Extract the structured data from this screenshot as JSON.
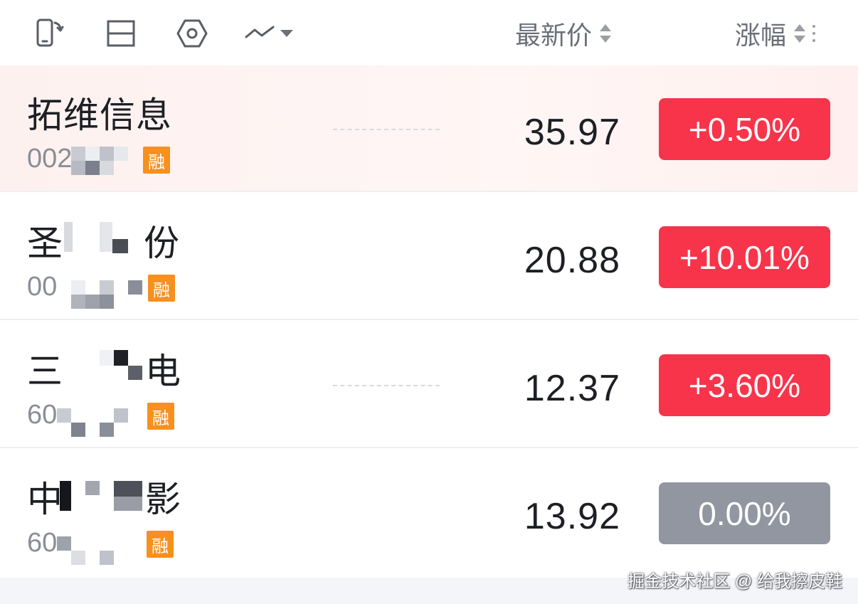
{
  "header": {
    "col_price": "最新价",
    "col_change": "涨幅",
    "icons": [
      "phone-rotate-icon",
      "split-layout-icon",
      "hexagon-settings-icon",
      "trend-line-icon",
      "caret-down-icon",
      "sort-icon",
      "more-vert-icon"
    ]
  },
  "rows": [
    {
      "name": "拓维信息",
      "code": "002",
      "badge": "融",
      "price": "35.97",
      "change": "+0.50%",
      "change_color": "#f7344a"
    },
    {
      "name_first": "圣",
      "name_last": "份",
      "code": "00",
      "badge": "融",
      "price": "20.88",
      "change": "+10.01%",
      "change_color": "#f7344a"
    },
    {
      "name_first": "三",
      "name_last": "电",
      "code": "60",
      "badge": "融",
      "price": "12.37",
      "change": "+3.60%",
      "change_color": "#f7344a"
    },
    {
      "name_first": "中",
      "name_last": "影",
      "code": "60",
      "badge": "融",
      "price": "13.92",
      "change": "0.00%",
      "change_color": "#9296a1"
    }
  ],
  "watermark": "掘金技术社区 @ 给我擦皮鞋"
}
